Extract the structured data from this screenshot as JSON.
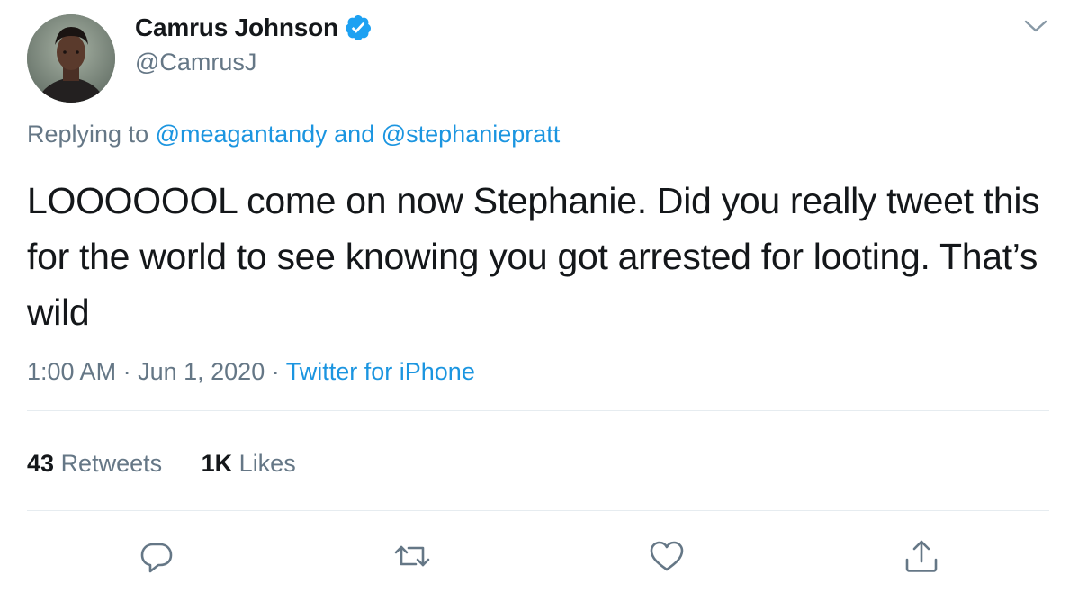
{
  "author": {
    "display_name": "Camrus Johnson",
    "handle": "@CamrusJ",
    "verified": true,
    "avatar_icon": "profile-photo"
  },
  "reply": {
    "prefix": "Replying to",
    "mention_1": "@meagantandy",
    "joiner": "and",
    "mention_2": "@stephaniepratt"
  },
  "tweet": {
    "text": "LOOOOOOL come on now Stephanie. Did you really tweet this for the world to see knowing you got arrested for looting. That’s wild",
    "time": "1:00 AM",
    "separator": "·",
    "date": "Jun 1, 2020",
    "source": "Twitter for iPhone"
  },
  "stats": {
    "retweets_count": "43",
    "retweets_label": "Retweets",
    "likes_count": "1K",
    "likes_label": "Likes"
  },
  "actions": {
    "reply_icon": "reply-icon",
    "retweet_icon": "retweet-icon",
    "like_icon": "heart-icon",
    "share_icon": "share-icon"
  },
  "colors": {
    "link": "#1b95e0",
    "secondary_text": "#657786",
    "verified_badge": "#1da1f2",
    "divider": "#e6ecf0"
  }
}
